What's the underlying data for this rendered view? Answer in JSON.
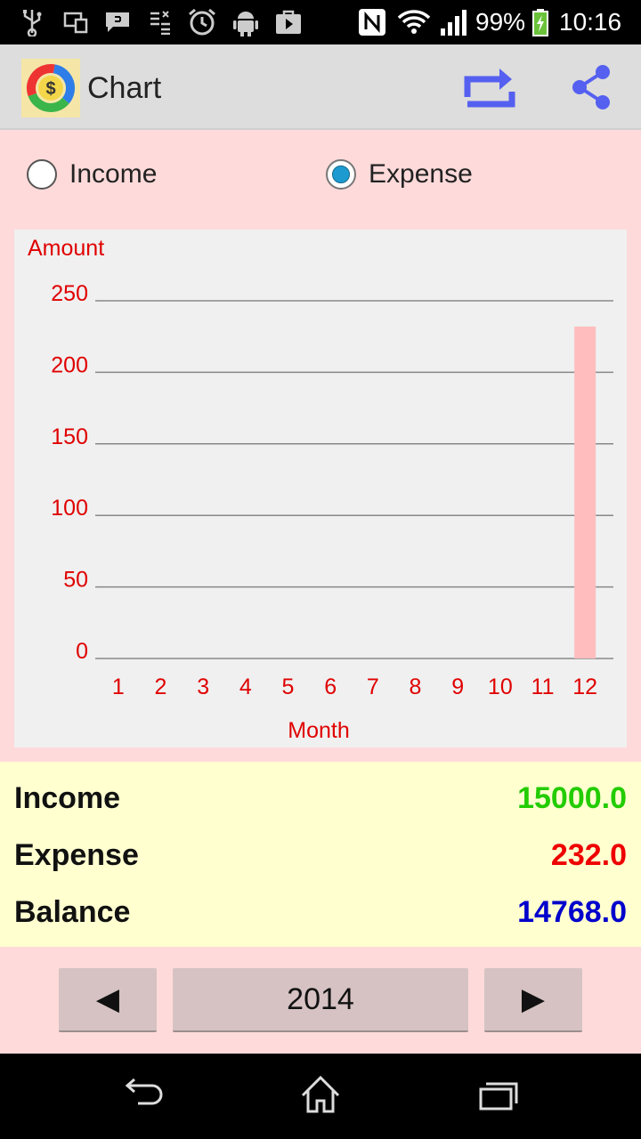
{
  "status_bar": {
    "battery": "99%",
    "time": "10:16",
    "icons": [
      "usb-icon",
      "devices-icon",
      "message-icon",
      "data-icon",
      "alarm-icon",
      "android-icon",
      "store-icon",
      "nfc-icon",
      "wifi-icon",
      "signal-icon",
      "battery-charging-icon"
    ]
  },
  "app_bar": {
    "title": "Chart",
    "actions": [
      "switch-icon",
      "share-icon"
    ]
  },
  "radio": {
    "income_label": "Income",
    "expense_label": "Expense",
    "selected": "Expense"
  },
  "chart_data": {
    "type": "bar",
    "ylabel": "Amount",
    "xlabel": "Month",
    "categories": [
      "1",
      "2",
      "3",
      "4",
      "5",
      "6",
      "7",
      "8",
      "9",
      "10",
      "11",
      "12"
    ],
    "values": [
      0,
      0,
      0,
      0,
      0,
      0,
      0,
      0,
      0,
      0,
      0,
      232
    ],
    "yticks": [
      "0",
      "50",
      "100",
      "150",
      "200",
      "250"
    ],
    "ylim": [
      0,
      250
    ],
    "grid": true,
    "bar_color": "#ffbdbd",
    "text_color": "#e00000"
  },
  "summary": {
    "income_label": "Income",
    "income_value": "15000.0",
    "expense_label": "Expense",
    "expense_value": "232.0",
    "balance_label": "Balance",
    "balance_value": "14768.0",
    "income_color": "#22cc00",
    "expense_color": "#ee0000",
    "balance_color": "#0000cc"
  },
  "year_nav": {
    "prev_symbol": "◀",
    "year": "2014",
    "next_symbol": "▶"
  },
  "system_nav": [
    "back-icon",
    "home-icon",
    "recents-icon"
  ]
}
